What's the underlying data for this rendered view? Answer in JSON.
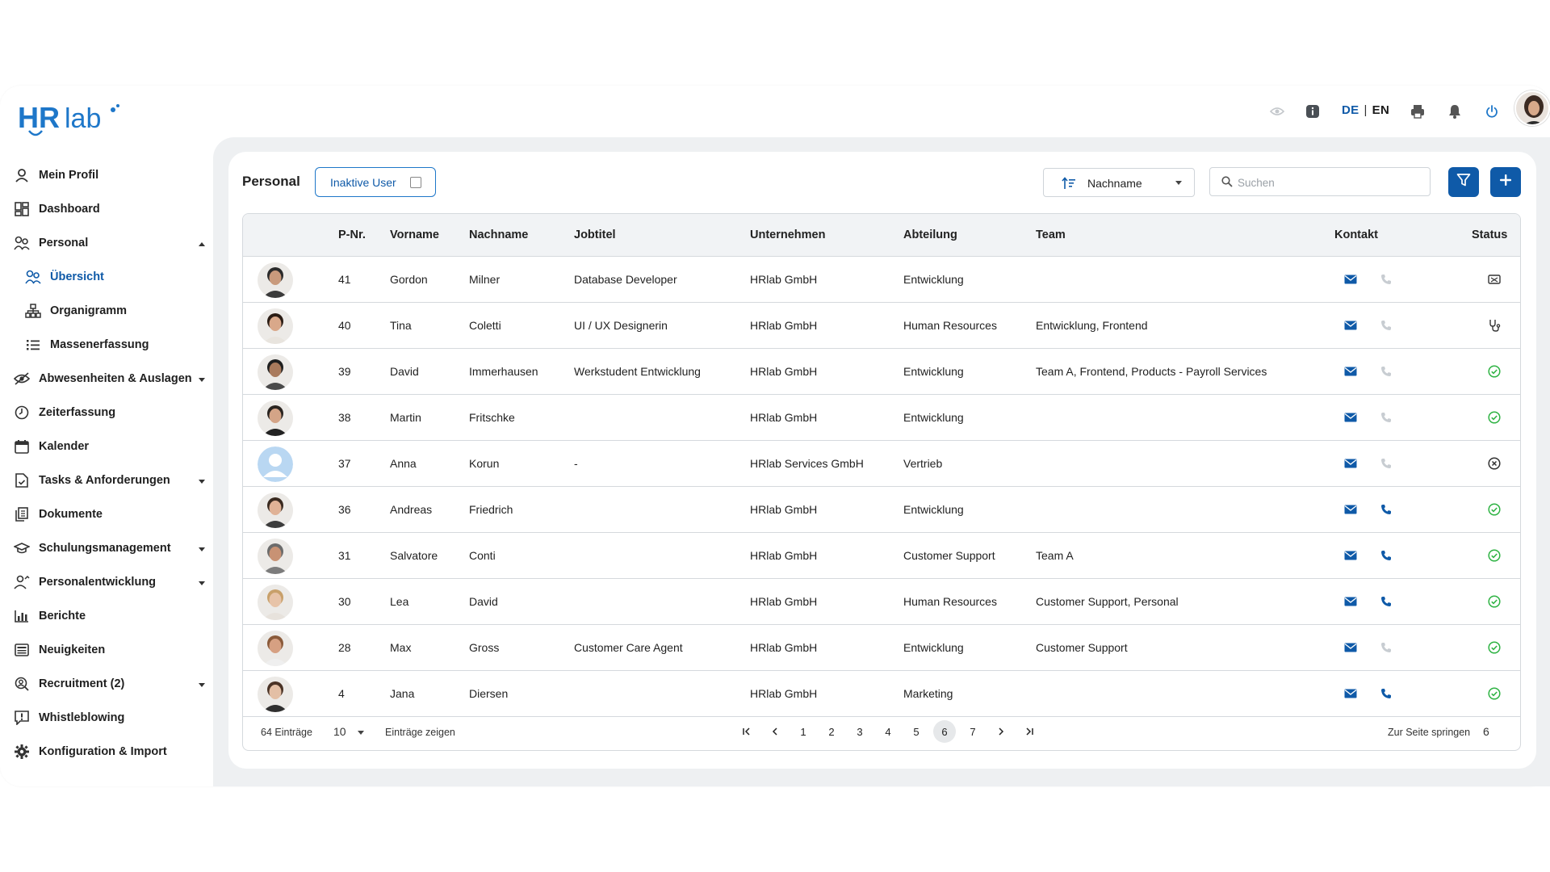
{
  "brand": {
    "logo_text_hr": "HR",
    "logo_text_lab": "lab"
  },
  "header": {
    "lang_de": "DE",
    "lang_sep": "|",
    "lang_en": "EN"
  },
  "sidebar": {
    "items": [
      {
        "label": "Mein Profil",
        "icon": "user-icon"
      },
      {
        "label": "Dashboard",
        "icon": "dashboard-icon"
      },
      {
        "label": "Personal",
        "icon": "people-icon",
        "expanded": true
      },
      {
        "label": "Übersicht",
        "icon": "people-icon",
        "active": true
      },
      {
        "label": "Organigramm",
        "icon": "org-chart-icon"
      },
      {
        "label": "Massenerfassung",
        "icon": "list-icon"
      },
      {
        "label": "Abwesenheiten & Auslagen",
        "icon": "absence-icon"
      },
      {
        "label": "Zeiterfassung",
        "icon": "clock-icon"
      },
      {
        "label": "Kalender",
        "icon": "calendar-icon"
      },
      {
        "label": "Tasks & Anforderungen",
        "icon": "task-icon"
      },
      {
        "label": "Dokumente",
        "icon": "documents-icon"
      },
      {
        "label": "Schulungsmanagement",
        "icon": "graduation-icon"
      },
      {
        "label": "Personalentwicklung",
        "icon": "development-icon"
      },
      {
        "label": "Berichte",
        "icon": "chart-icon"
      },
      {
        "label": "Neuigkeiten",
        "icon": "news-icon"
      },
      {
        "label": "Recruitment (2)",
        "icon": "recruitment-icon"
      },
      {
        "label": "Whistleblowing",
        "icon": "whistleblowing-icon"
      },
      {
        "label": "Konfiguration & Import",
        "icon": "gear-icon"
      }
    ]
  },
  "toolbar": {
    "title": "Personal",
    "inactive_label": "Inaktive User",
    "sort_label": "Nachname",
    "search_placeholder": "Suchen"
  },
  "table": {
    "columns": {
      "pnr": "P-Nr.",
      "first": "Vorname",
      "last": "Nachname",
      "job": "Jobtitel",
      "company": "Unternehmen",
      "dept": "Abteilung",
      "team": "Team",
      "contact": "Kontakt",
      "status": "Status"
    },
    "rows": [
      {
        "pnr": "41",
        "first": "Gordon",
        "last": "Milner",
        "job": "Database Developer",
        "company": "HRlab GmbH",
        "dept": "Entwicklung",
        "team": "",
        "phone": false,
        "status": "absent-icon"
      },
      {
        "pnr": "40",
        "first": "Tina",
        "last": "Coletti",
        "job": "UI / UX Designerin",
        "company": "HRlab GmbH",
        "dept": "Human Resources",
        "team": "Entwicklung, Frontend",
        "phone": false,
        "status": "sick-icon"
      },
      {
        "pnr": "39",
        "first": "David",
        "last": "Immerhausen",
        "job": "Werkstudent Entwicklung",
        "company": "HRlab GmbH",
        "dept": "Entwicklung",
        "team": "Team A, Frontend, Products - Payroll Services",
        "phone": false,
        "status": "check-circle-icon"
      },
      {
        "pnr": "38",
        "first": "Martin",
        "last": "Fritschke",
        "job": "",
        "company": "HRlab GmbH",
        "dept": "Entwicklung",
        "team": "",
        "phone": false,
        "status": "check-circle-icon"
      },
      {
        "pnr": "37",
        "first": "Anna",
        "last": "Korun",
        "job": "-",
        "company": "HRlab Services GmbH",
        "dept": "Vertrieb",
        "team": "",
        "phone": false,
        "status": "x-circle-icon"
      },
      {
        "pnr": "36",
        "first": "Andreas",
        "last": "Friedrich",
        "job": "",
        "company": "HRlab GmbH",
        "dept": "Entwicklung",
        "team": "",
        "phone": true,
        "status": "check-circle-icon"
      },
      {
        "pnr": "31",
        "first": "Salvatore",
        "last": "Conti",
        "job": "",
        "company": "HRlab GmbH",
        "dept": "Customer Support",
        "team": "Team A",
        "phone": true,
        "status": "check-circle-icon"
      },
      {
        "pnr": "30",
        "first": "Lea",
        "last": "David",
        "job": "",
        "company": "HRlab GmbH",
        "dept": "Human Resources",
        "team": "Customer Support, Personal",
        "phone": true,
        "status": "check-circle-icon"
      },
      {
        "pnr": "28",
        "first": "Max",
        "last": "Gross",
        "job": "Customer Care Agent",
        "company": "HRlab GmbH",
        "dept": "Entwicklung",
        "team": "Customer Support",
        "phone": false,
        "status": "check-circle-icon"
      },
      {
        "pnr": "4",
        "first": "Jana",
        "last": "Diersen",
        "job": "",
        "company": "HRlab GmbH",
        "dept": "Marketing",
        "team": "",
        "phone": true,
        "status": "check-circle-icon"
      }
    ]
  },
  "footer": {
    "entries_count": "64 Einträge",
    "page_size": "10",
    "page_size_label": "Einträge zeigen",
    "pages": [
      "1",
      "2",
      "3",
      "4",
      "5",
      "6",
      "7"
    ],
    "current_page": "6",
    "jump_label": "Zur Seite springen",
    "jump_value": "6"
  },
  "colors": {
    "primary": "#0f5aa8",
    "success": "#2fb344",
    "muted": "#c8cdd2"
  }
}
